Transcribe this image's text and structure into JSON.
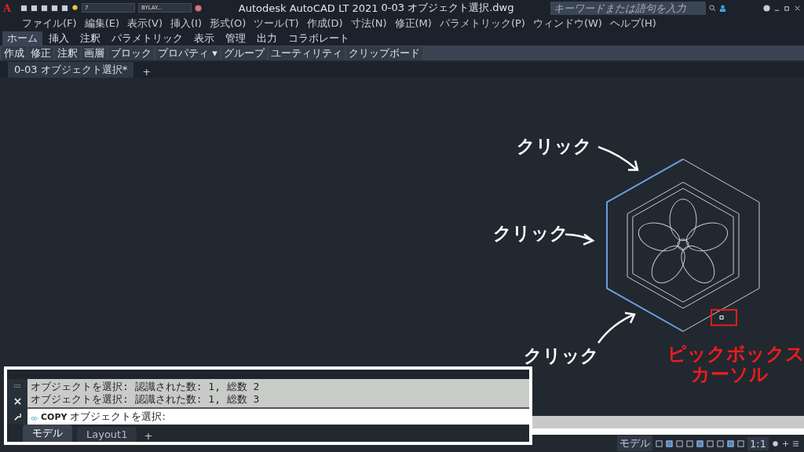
{
  "title_bar": {
    "logo": "A",
    "layer": "7",
    "linetype": "BYLAY...",
    "title": "Autodesk AutoCAD LT 2021",
    "file": "0-03 オブジェクト選択.dwg",
    "search": {
      "placeholder": "キーワードまたは語句を入力"
    }
  },
  "menu": [
    "ファイル(F)",
    "編集(E)",
    "表示(V)",
    "挿入(I)",
    "形式(O)",
    "ツール(T)",
    "作成(D)",
    "寸法(N)",
    "修正(M)",
    "パラメトリック(P)",
    "ウィンドウ(W)",
    "ヘルプ(H)"
  ],
  "ribbon_tabs": [
    {
      "label": "ホーム",
      "selected": true
    },
    {
      "label": "挿入",
      "selected": false
    },
    {
      "label": "注釈",
      "selected": false
    },
    {
      "label": "パラメトリック",
      "selected": false
    },
    {
      "label": "表示",
      "selected": false
    },
    {
      "label": "管理",
      "selected": false
    },
    {
      "label": "出力",
      "selected": false
    },
    {
      "label": "コラボレート",
      "selected": false
    }
  ],
  "panels": [
    "作成",
    "修正",
    "注釈",
    "画層",
    "ブロック",
    "プロパティ ▾",
    "グループ",
    "ユーティリティ",
    "クリップボード"
  ],
  "doc_tabs": [
    {
      "label": "0-03 オブジェクト選択*",
      "selected": true
    }
  ],
  "doc_tab_add": "+",
  "canvas": {
    "click_labels": [
      "クリック",
      "クリック",
      "クリック"
    ],
    "pickbox_label": [
      "ピックボックス",
      "カーソル"
    ]
  },
  "command_line": {
    "history": [
      "オブジェクトを選択: 認識された数: 1, 総数 2",
      "オブジェクトを選択: 認識された数: 1, 総数 3"
    ],
    "command": "COPY",
    "prompt": "オブジェクトを選択:"
  },
  "layout_tabs": [
    {
      "label": "モデル",
      "selected": true
    },
    {
      "label": "Layout1",
      "selected": false
    }
  ],
  "layout_tab_add": "+",
  "status_bar": {
    "model": "モデル",
    "scale": "1:1"
  }
}
